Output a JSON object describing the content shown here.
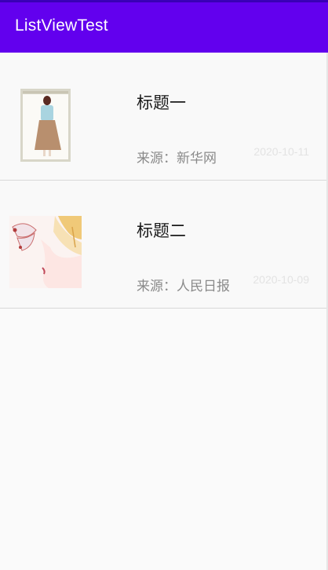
{
  "app": {
    "title": "ListViewTest",
    "primary_color": "#6200ee"
  },
  "news": [
    {
      "title": "标题一",
      "source": "来源：新华网",
      "date": "2020-10-11",
      "image": "girl-illustration"
    },
    {
      "title": "标题二",
      "source": "来源：人民日报",
      "date": "2020-10-09",
      "image": "butterfly-illustration"
    }
  ]
}
